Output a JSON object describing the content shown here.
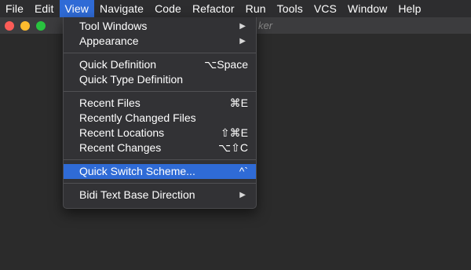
{
  "menubar": {
    "items": [
      {
        "label": "File"
      },
      {
        "label": "Edit"
      },
      {
        "label": "View"
      },
      {
        "label": "Navigate"
      },
      {
        "label": "Code"
      },
      {
        "label": "Refactor"
      },
      {
        "label": "Run"
      },
      {
        "label": "Tools"
      },
      {
        "label": "VCS"
      },
      {
        "label": "Window"
      },
      {
        "label": "Help"
      }
    ],
    "active": "View"
  },
  "window": {
    "title_fragment": "ker"
  },
  "view_menu": {
    "groups": [
      [
        {
          "label": "Tool Windows",
          "shortcut": "",
          "submenu_arrow": "▶"
        },
        {
          "label": "Appearance",
          "shortcut": "",
          "submenu_arrow": "▶"
        }
      ],
      [
        {
          "label": "Quick Definition",
          "shortcut": "⌥Space"
        },
        {
          "label": "Quick Type Definition",
          "shortcut": ""
        }
      ],
      [
        {
          "label": "Recent Files",
          "shortcut": "⌘E"
        },
        {
          "label": "Recently Changed Files",
          "shortcut": ""
        },
        {
          "label": "Recent Locations",
          "shortcut": "⇧⌘E"
        },
        {
          "label": "Recent Changes",
          "shortcut": "⌥⇧C"
        }
      ],
      [
        {
          "label": "Quick Switch Scheme...",
          "shortcut": "^`",
          "highlighted": true
        }
      ],
      [
        {
          "label": "Bidi Text Base Direction",
          "shortcut": "",
          "submenu_arrow": "▶"
        }
      ]
    ]
  },
  "colors": {
    "highlight": "#2f6bd6",
    "menu_bg": "#323235",
    "editor_bg": "#2b2b2b"
  }
}
